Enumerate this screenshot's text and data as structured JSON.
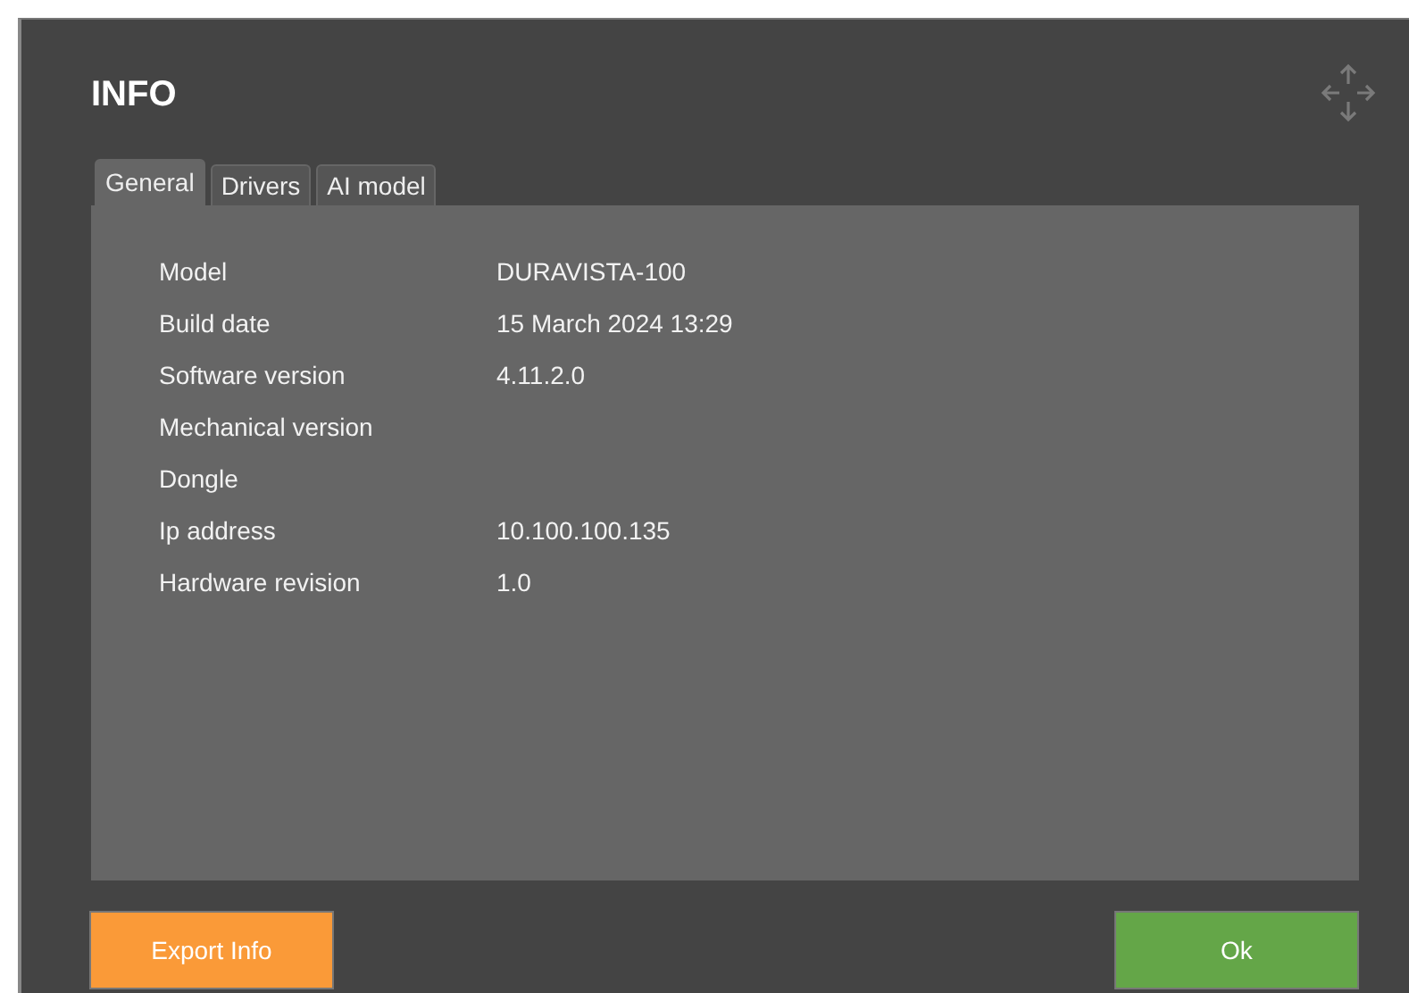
{
  "dialog": {
    "title": "INFO"
  },
  "tabs": [
    {
      "label": "General",
      "selected": true
    },
    {
      "label": "Drivers",
      "selected": false
    },
    {
      "label": "AI model",
      "selected": false
    }
  ],
  "fields": [
    {
      "label": "Model",
      "value": "DURAVISTA-100"
    },
    {
      "label": "Build date",
      "value": "15 March 2024 13:29"
    },
    {
      "label": "Software version",
      "value": "4.11.2.0"
    },
    {
      "label": "Mechanical version"
    },
    {
      "label": "Dongle"
    },
    {
      "label": "Ip address",
      "value": "10.100.100.135"
    },
    {
      "label": "Hardware revision",
      "value": "1.0"
    }
  ],
  "buttons": [
    {
      "label": "Export Info",
      "kind": "export"
    },
    {
      "label": "Ok",
      "kind": "ok"
    }
  ]
}
